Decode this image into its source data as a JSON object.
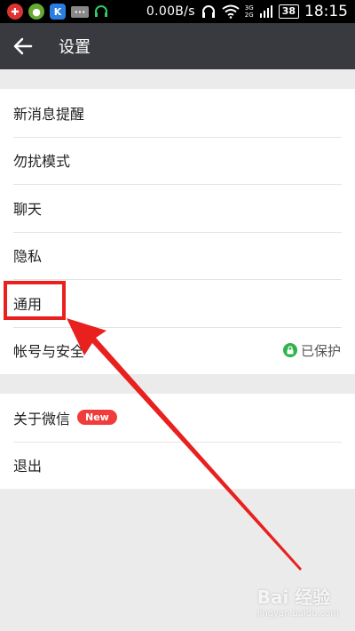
{
  "status_bar": {
    "network_speed": "0.00B/s",
    "gen_top": "3G",
    "gen_bottom": "2G",
    "battery": "38",
    "time": "18:15",
    "icons": [
      "notification-red-icon",
      "app-green-icon",
      "k-app-icon",
      "message-icon",
      "headset-icon",
      "headphones-icon",
      "wifi-icon",
      "signal-icon"
    ]
  },
  "header": {
    "back_icon": "arrow-left-icon",
    "title": "设置"
  },
  "settings": {
    "group1": [
      {
        "label": "新消息提醒"
      },
      {
        "label": "勿扰模式"
      },
      {
        "label": "聊天"
      },
      {
        "label": "隐私"
      },
      {
        "label": "通用"
      },
      {
        "label": "帐号与安全",
        "status": "已保护",
        "status_icon": "lock-icon"
      }
    ],
    "group2": [
      {
        "label": "关于微信",
        "badge": "New"
      },
      {
        "label": "退出"
      }
    ]
  },
  "annotation": {
    "highlight_color": "#e8211f",
    "highlighted_item": "通用"
  },
  "watermark": {
    "text": "Bai 经验",
    "sub": "jingyan.baidu.com"
  },
  "colors": {
    "titlebar_bg": "#393a3f",
    "page_bg": "#ebebeb",
    "lock_green": "#2fb44a",
    "badge_red": "#f23b3b"
  }
}
